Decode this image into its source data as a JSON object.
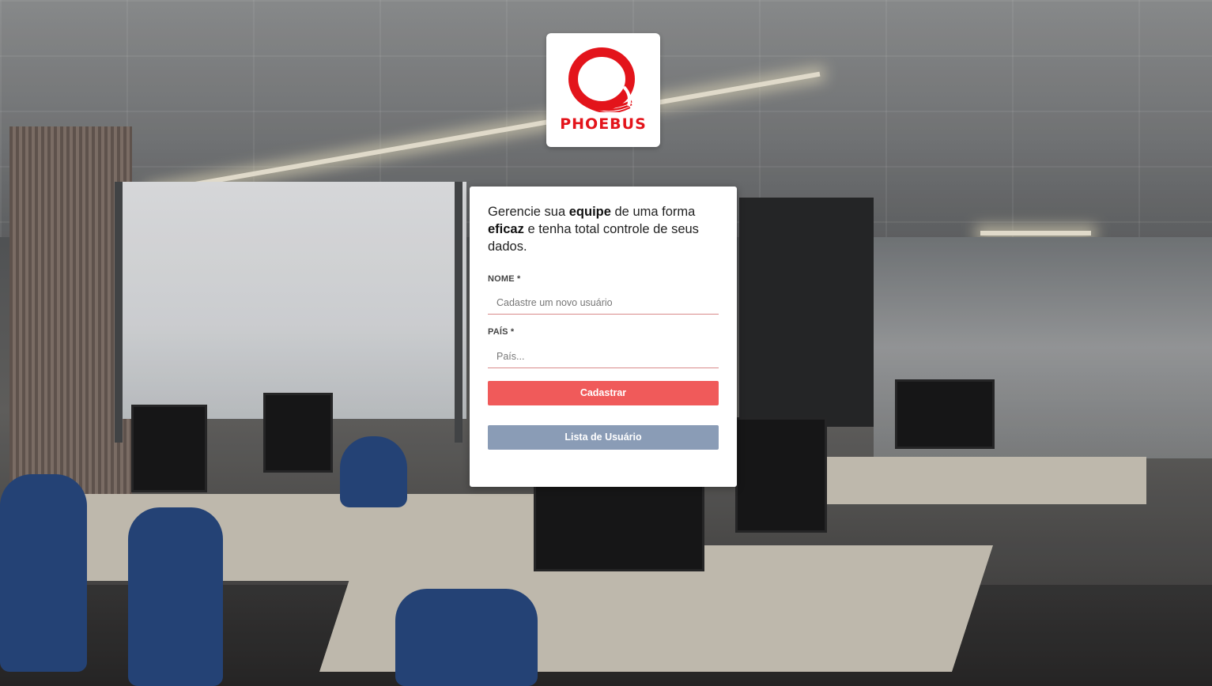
{
  "brand": {
    "logo_text": "PHOEBUS",
    "logo_color": "#e3141b"
  },
  "form": {
    "tagline": {
      "part1": "Gerencie sua ",
      "bold1": "equipe",
      "part2": " de uma forma ",
      "bold2": "eficaz",
      "part3": " e tenha total controle de seus dados."
    },
    "name_label": "NOME *",
    "name_placeholder": "Cadastre um novo usuário",
    "country_label": "PAÍS *",
    "country_placeholder": "País...",
    "submit_label": "Cadastrar",
    "list_label": "Lista de Usuário"
  },
  "colors": {
    "primary_button": "#f05a5a",
    "secondary_button": "#8a9cb6",
    "input_underline": "#d98a8a"
  }
}
